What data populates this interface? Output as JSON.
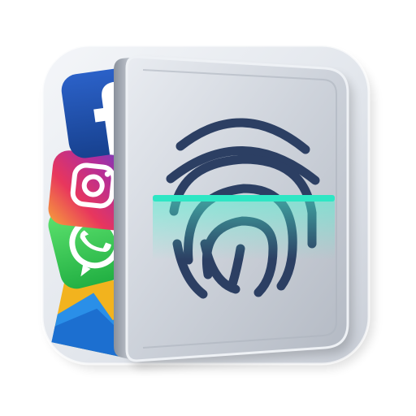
{
  "app_icon": {
    "colors": {
      "background": "#ffffff",
      "base_plate": "#e4e8ee",
      "door_face": "#cfd4dc",
      "fingerprint": "#2c3f63",
      "scan_line": "#2ee6c4",
      "facebook": "#1f4fae",
      "whatsapp": "#3ad05a",
      "gallery": "#f2b31e"
    },
    "icons": {
      "facebook": "facebook-icon",
      "instagram": "instagram-icon",
      "whatsapp": "whatsapp-icon",
      "gallery": "gallery-icon",
      "fingerprint": "fingerprint-icon"
    }
  }
}
